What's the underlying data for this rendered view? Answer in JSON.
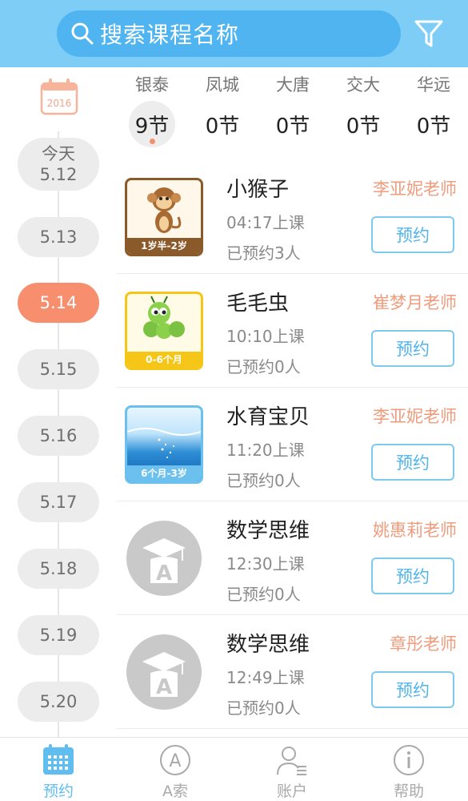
{
  "header": {
    "search_placeholder": "搜索课程名称",
    "search_icon": "search-icon",
    "filter_icon": "filter-icon",
    "background_color": "#7dcdf6"
  },
  "calendar": {
    "year_label": "2016",
    "icon": "calendar-icon"
  },
  "dates": [
    {
      "top": "今天",
      "bottom": "5.12"
    },
    {
      "label": "5.13"
    },
    {
      "label": "5.14",
      "active": true
    },
    {
      "label": "5.15"
    },
    {
      "label": "5.16"
    },
    {
      "label": "5.17"
    },
    {
      "label": "5.18"
    },
    {
      "label": "5.19"
    },
    {
      "label": "5.20"
    }
  ],
  "campuses": [
    {
      "name": "银泰",
      "count": "9节",
      "active": true
    },
    {
      "name": "凤城",
      "count": "0节"
    },
    {
      "name": "大唐",
      "count": "0节"
    },
    {
      "name": "交大",
      "count": "0节"
    },
    {
      "name": "华远",
      "count": "0节"
    }
  ],
  "courses": [
    {
      "name": "小猴子",
      "time": "04:17上课",
      "booked": "已预约3人",
      "teacher": "李亚妮老师",
      "button": "预约",
      "age_badge": "1岁半-2岁",
      "thumb": "monkey-icon"
    },
    {
      "name": "毛毛虫",
      "time": "10:10上课",
      "booked": "已预约0人",
      "teacher": "崔梦月老师",
      "button": "预约",
      "age_badge": "0-6个月",
      "thumb": "caterpillar-icon"
    },
    {
      "name": "水育宝贝",
      "time": "11:20上课",
      "booked": "已预约0人",
      "teacher": "李亚妮老师",
      "button": "预约",
      "age_badge": "6个月-3岁",
      "thumb": "water-icon"
    },
    {
      "name": "数学思维",
      "time": "12:30上课",
      "booked": "已预约0人",
      "teacher": "姚惠莉老师",
      "button": "预约",
      "thumb": "graduation-placeholder-icon"
    },
    {
      "name": "数学思维",
      "time": "12:49上课",
      "booked": "已预约0人",
      "teacher": "章彤老师",
      "button": "预约",
      "thumb": "graduation-placeholder-icon"
    }
  ],
  "tabbar": [
    {
      "label": "预约",
      "icon": "calendar-grid-icon",
      "active": true
    },
    {
      "label": "A索",
      "icon": "circle-a-icon"
    },
    {
      "label": "账户",
      "icon": "account-icon"
    },
    {
      "label": "帮助",
      "icon": "info-icon"
    }
  ],
  "colors": {
    "accent_blue": "#4fb4ef",
    "accent_orange": "#f78f6e",
    "teacher_text": "#ef9b7c"
  }
}
